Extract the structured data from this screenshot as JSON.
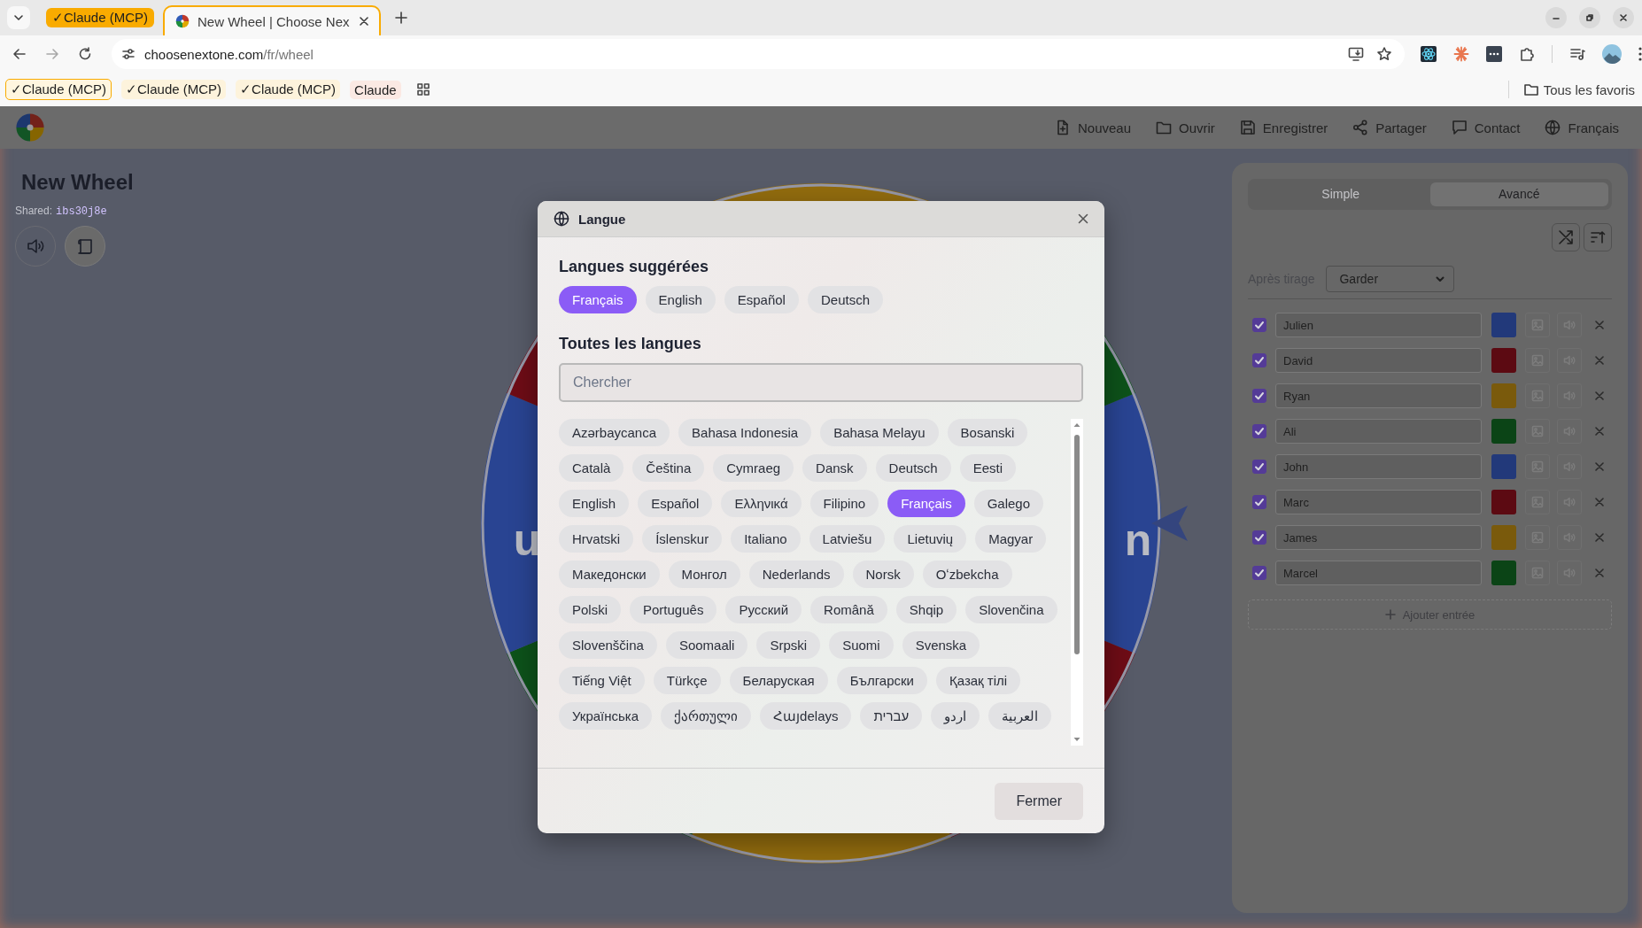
{
  "browser": {
    "tab_group": {
      "label": "✓Claude (MCP)"
    },
    "tabs": [
      {
        "title": "New Wheel | Choose Nex",
        "selected": true
      }
    ],
    "url": {
      "domain": "choosenextone.com",
      "path": "/fr/wheel"
    },
    "bookmarks": [
      {
        "label": "✓Claude (MCP)",
        "kind": "outlined"
      },
      {
        "label": "✓Claude (MCP)",
        "kind": "tinted"
      },
      {
        "label": "✓Claude (MCP)",
        "kind": "tinted"
      },
      {
        "label": "Claude",
        "kind": "rose"
      }
    ],
    "all_bookmarks": "Tous les favoris"
  },
  "app": {
    "nav": [
      {
        "label": "Nouveau"
      },
      {
        "label": "Ouvrir"
      },
      {
        "label": "Enregistrer"
      },
      {
        "label": "Partager"
      },
      {
        "label": "Contact"
      },
      {
        "label": "Français"
      }
    ],
    "wheel_title": "New Wheel",
    "shared_label": "Shared:",
    "share_code": "ibs30j8e",
    "wheel": {
      "labels": [
        {
          "text": "u"
        },
        {
          "text": "n"
        }
      ]
    },
    "panel": {
      "tabs": [
        {
          "label": "Simple",
          "selected": false
        },
        {
          "label": "Avancé",
          "selected": true
        }
      ],
      "after_draw": {
        "label": "Après tirage",
        "value": "Garder"
      },
      "entries": [
        {
          "name": "Julien",
          "checked": true,
          "color": "#22397a"
        },
        {
          "name": "David",
          "checked": true,
          "color": "#5c0a12"
        },
        {
          "name": "Ryan",
          "checked": true,
          "color": "#7a5a0c"
        },
        {
          "name": "Ali",
          "checked": true,
          "color": "#0b4416"
        },
        {
          "name": "John",
          "checked": true,
          "color": "#22397a"
        },
        {
          "name": "Marc",
          "checked": true,
          "color": "#5c0a12"
        },
        {
          "name": "James",
          "checked": true,
          "color": "#7a5a0c"
        },
        {
          "name": "Marcel",
          "checked": true,
          "color": "#0b4416"
        }
      ],
      "add_button": "Ajouter entrée"
    }
  },
  "dialog": {
    "title": "Langue",
    "suggested_heading": "Langues suggérées",
    "suggested": [
      {
        "label": "Français",
        "selected": true
      },
      {
        "label": "English",
        "selected": false
      },
      {
        "label": "Español",
        "selected": false
      },
      {
        "label": "Deutsch",
        "selected": false
      }
    ],
    "all_heading": "Toutes les langues",
    "search": {
      "placeholder": "Chercher"
    },
    "language_rows": [
      [
        {
          "label": "Azərbaycanca",
          "selected": false
        },
        {
          "label": "Bahasa Indonesia",
          "selected": false
        },
        {
          "label": "Bahasa Melayu",
          "selected": false
        },
        {
          "label": "Bosanski",
          "selected": false
        }
      ],
      [
        {
          "label": "Català",
          "selected": false
        },
        {
          "label": "Čeština",
          "selected": false
        },
        {
          "label": "Cymraeg",
          "selected": false
        },
        {
          "label": "Dansk",
          "selected": false
        },
        {
          "label": "Deutsch",
          "selected": false
        },
        {
          "label": "Eesti",
          "selected": false
        }
      ],
      [
        {
          "label": "English",
          "selected": false
        },
        {
          "label": "Español",
          "selected": false
        },
        {
          "label": "Ελληνικά",
          "selected": false
        },
        {
          "label": "Filipino",
          "selected": false
        },
        {
          "label": "Français",
          "selected": true
        },
        {
          "label": "Galego",
          "selected": false
        }
      ],
      [
        {
          "label": "Hrvatski",
          "selected": false
        },
        {
          "label": "Íslenskur",
          "selected": false
        },
        {
          "label": "Italiano",
          "selected": false
        },
        {
          "label": "Latviešu",
          "selected": false
        },
        {
          "label": "Lietuvių",
          "selected": false
        },
        {
          "label": "Magyar",
          "selected": false
        }
      ],
      [
        {
          "label": "Македонски",
          "selected": false
        },
        {
          "label": "Монгол",
          "selected": false
        },
        {
          "label": "Nederlands",
          "selected": false
        },
        {
          "label": "Norsk",
          "selected": false
        },
        {
          "label": "Oʻzbekcha",
          "selected": false
        }
      ],
      [
        {
          "label": "Polski",
          "selected": false
        },
        {
          "label": "Português",
          "selected": false
        },
        {
          "label": "Русский",
          "selected": false
        },
        {
          "label": "Română",
          "selected": false
        },
        {
          "label": "Shqip",
          "selected": false
        },
        {
          "label": "Slovenčina",
          "selected": false
        }
      ],
      [
        {
          "label": "Slovenščina",
          "selected": false
        },
        {
          "label": "Soomaali",
          "selected": false
        },
        {
          "label": "Srpski",
          "selected": false
        },
        {
          "label": "Suomi",
          "selected": false
        },
        {
          "label": "Svenska",
          "selected": false
        }
      ],
      [
        {
          "label": "Tiếng Việt",
          "selected": false
        },
        {
          "label": "Türkçe",
          "selected": false
        },
        {
          "label": "Беларуская",
          "selected": false
        },
        {
          "label": "Български",
          "selected": false
        },
        {
          "label": "Қазақ тілі",
          "selected": false
        }
      ],
      [
        {
          "label": "Українська",
          "selected": false
        },
        {
          "label": "ქართული",
          "selected": false
        },
        {
          "label": "Հայdelays",
          "selected": false
        },
        {
          "label": "עברית",
          "selected": false
        },
        {
          "label": "اردو",
          "selected": false
        },
        {
          "label": "العربية",
          "selected": false
        }
      ]
    ],
    "close_button": "Fermer"
  }
}
